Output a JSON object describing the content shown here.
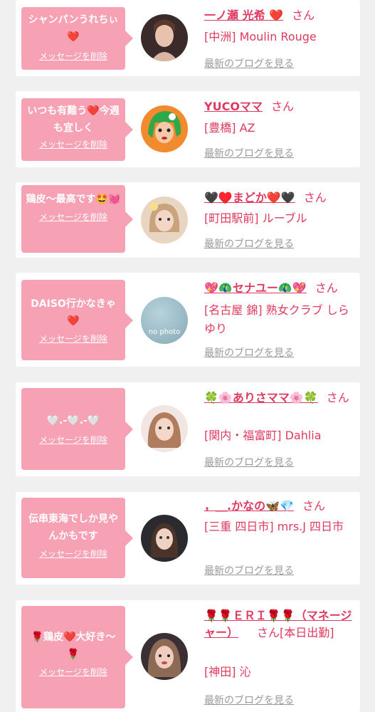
{
  "messages": [
    {
      "bubble": "シャンパンうれちぃ❤️",
      "delete_label": "メッセージを削除",
      "name": "一ノ瀬 光希 ❤️",
      "san": "さん",
      "shop": "[中洲] Moulin Rouge",
      "blog": "最新のブログを見る",
      "avatar": "photo-woman-avatar"
    },
    {
      "bubble": "いつも有難う❤️今週も宜しく",
      "delete_label": "メッセージを削除",
      "name": "YUCOママ",
      "san": "さん",
      "shop": "[豊橋] AZ",
      "blog": "最新のブログを見る",
      "avatar": "green-hair-illustration-avatar"
    },
    {
      "bubble": "鶏皮〜最高です🤩💓",
      "delete_label": "メッセージを削除",
      "name": "🖤♥️まどか❤️🖤",
      "san": "さん",
      "shop": "[町田駅前] ルーブル",
      "blog": "最新のブログを見る",
      "avatar": "photo-woman-avatar"
    },
    {
      "bubble": "DAISO行かなきゃ❤️",
      "delete_label": "メッセージを削除",
      "name": "💖🦚セナユー🦚💖",
      "san": "さん",
      "shop": "[名古屋 錦] 熟女クラブ しらゆり",
      "blog": "最新のブログを見る",
      "avatar": "no-photo-avatar",
      "avatar_text": "no photo"
    },
    {
      "bubble": "🤍.-🤍.-🤍",
      "delete_label": "メッセージを削除",
      "name": "🍀🌸ありさママ🌸🍀",
      "san": "さん",
      "shop": "[関内・福富町] Dahlia",
      "blog": "最新のブログを見る",
      "avatar": "photo-woman-avatar"
    },
    {
      "bubble": "伝串東海でしか見やんかもです",
      "delete_label": "メッセージを削除",
      "name": "，＿.かなの🦋💎",
      "san": "さん",
      "shop": "[三重 四日市] mrs.J 四日市",
      "blog": "最新のブログを見る",
      "avatar": "photo-woman-avatar"
    },
    {
      "bubble": "🌹鶏皮❤️大好き〜🌹",
      "delete_label": "メッセージを削除",
      "name": "🌹🌹ＥＲＩ🌹🌹（マネージャー）",
      "san": "さん[本日出勤]",
      "shop": "[神田] 沁",
      "blog": "最新のブログを見る",
      "avatar": "photo-woman-avatar"
    }
  ],
  "colors": {
    "bubble": "#f7a1b5",
    "accent": "#e0395f",
    "link_gray": "#9a9a9a",
    "background": "#f0f0f0"
  }
}
